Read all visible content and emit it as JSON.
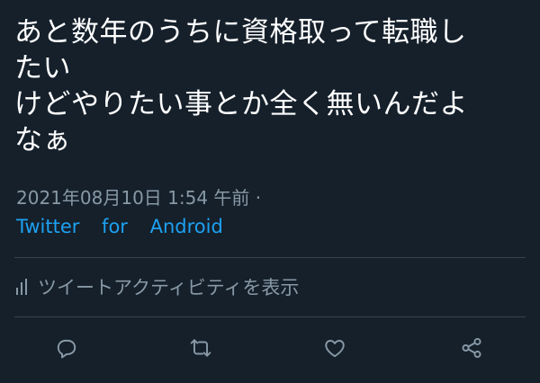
{
  "tweet": {
    "text_lines": [
      "あと数年のうちに資格取って転職し",
      "たい",
      "けどやりたい事とか全く無いんだよ",
      "なぁ"
    ],
    "timestamp": "2021年08月10日 1:54 午前 ·",
    "source": "Twitter for Android"
  },
  "activity": {
    "label": "ツイートアクティビティを表示",
    "icon": "analytics-bars-icon"
  },
  "actions": {
    "icons": [
      "reply-icon",
      "retweet-icon",
      "like-icon",
      "share-icon"
    ]
  },
  "colors": {
    "background": "#15202b",
    "text": "#ffffff",
    "secondary": "#8899a6",
    "link": "#1da1f2",
    "divider": "#38444d"
  }
}
